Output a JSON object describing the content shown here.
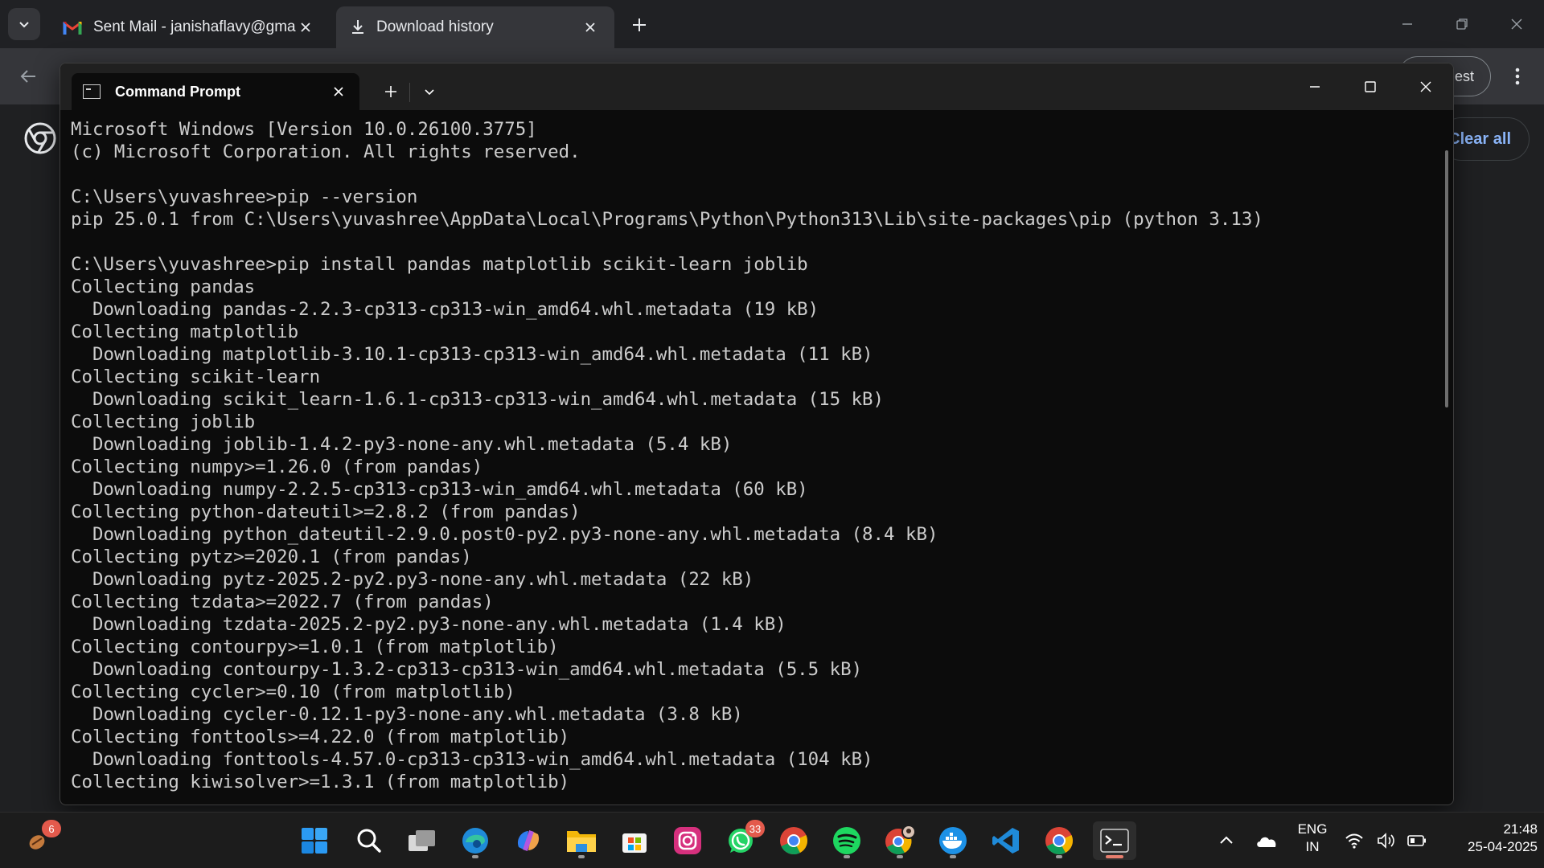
{
  "browser": {
    "tabs": [
      {
        "title": "Sent Mail - janishaflavy@gmail.",
        "icon": "gmail-icon",
        "active": false
      },
      {
        "title": "Download history",
        "icon": "download-icon",
        "active": true
      }
    ],
    "profile_label": "uest",
    "clear_all_label": "Clear all"
  },
  "terminal": {
    "tab_title": "Command Prompt",
    "lines": [
      "Microsoft Windows [Version 10.0.26100.3775]",
      "(c) Microsoft Corporation. All rights reserved.",
      "",
      "C:\\Users\\yuvashree>pip --version",
      "pip 25.0.1 from C:\\Users\\yuvashree\\AppData\\Local\\Programs\\Python\\Python313\\Lib\\site-packages\\pip (python 3.13)",
      "",
      "C:\\Users\\yuvashree>pip install pandas matplotlib scikit-learn joblib",
      "Collecting pandas",
      "  Downloading pandas-2.2.3-cp313-cp313-win_amd64.whl.metadata (19 kB)",
      "Collecting matplotlib",
      "  Downloading matplotlib-3.10.1-cp313-cp313-win_amd64.whl.metadata (11 kB)",
      "Collecting scikit-learn",
      "  Downloading scikit_learn-1.6.1-cp313-cp313-win_amd64.whl.metadata (15 kB)",
      "Collecting joblib",
      "  Downloading joblib-1.4.2-py3-none-any.whl.metadata (5.4 kB)",
      "Collecting numpy>=1.26.0 (from pandas)",
      "  Downloading numpy-2.2.5-cp313-cp313-win_amd64.whl.metadata (60 kB)",
      "Collecting python-dateutil>=2.8.2 (from pandas)",
      "  Downloading python_dateutil-2.9.0.post0-py2.py3-none-any.whl.metadata (8.4 kB)",
      "Collecting pytz>=2020.1 (from pandas)",
      "  Downloading pytz-2025.2-py2.py3-none-any.whl.metadata (22 kB)",
      "Collecting tzdata>=2022.7 (from pandas)",
      "  Downloading tzdata-2025.2-py2.py3-none-any.whl.metadata (1.4 kB)",
      "Collecting contourpy>=1.0.1 (from matplotlib)",
      "  Downloading contourpy-1.3.2-cp313-cp313-win_amd64.whl.metadata (5.5 kB)",
      "Collecting cycler>=0.10 (from matplotlib)",
      "  Downloading cycler-0.12.1-py3-none-any.whl.metadata (3.8 kB)",
      "Collecting fonttools>=4.22.0 (from matplotlib)",
      "  Downloading fonttools-4.57.0-cp313-cp313-win_amd64.whl.metadata (104 kB)",
      "Collecting kiwisolver>=1.3.1 (from matplotlib)"
    ]
  },
  "taskbar": {
    "widgets_badge": "6",
    "whatsapp_badge": "33",
    "apps": [
      "start-icon",
      "search-icon",
      "task-view-icon",
      "edge-icon",
      "copilot-icon",
      "file-explorer-icon",
      "microsoft-store-icon",
      "instagram-icon",
      "whatsapp-icon",
      "chrome-icon",
      "spotify-icon",
      "chrome-profile-icon",
      "docker-icon",
      "vscode-icon",
      "chrome-icon-2",
      "terminal-icon"
    ],
    "language_line1": "ENG",
    "language_line2": "IN",
    "time": "21:48",
    "date": "25-04-2025"
  }
}
